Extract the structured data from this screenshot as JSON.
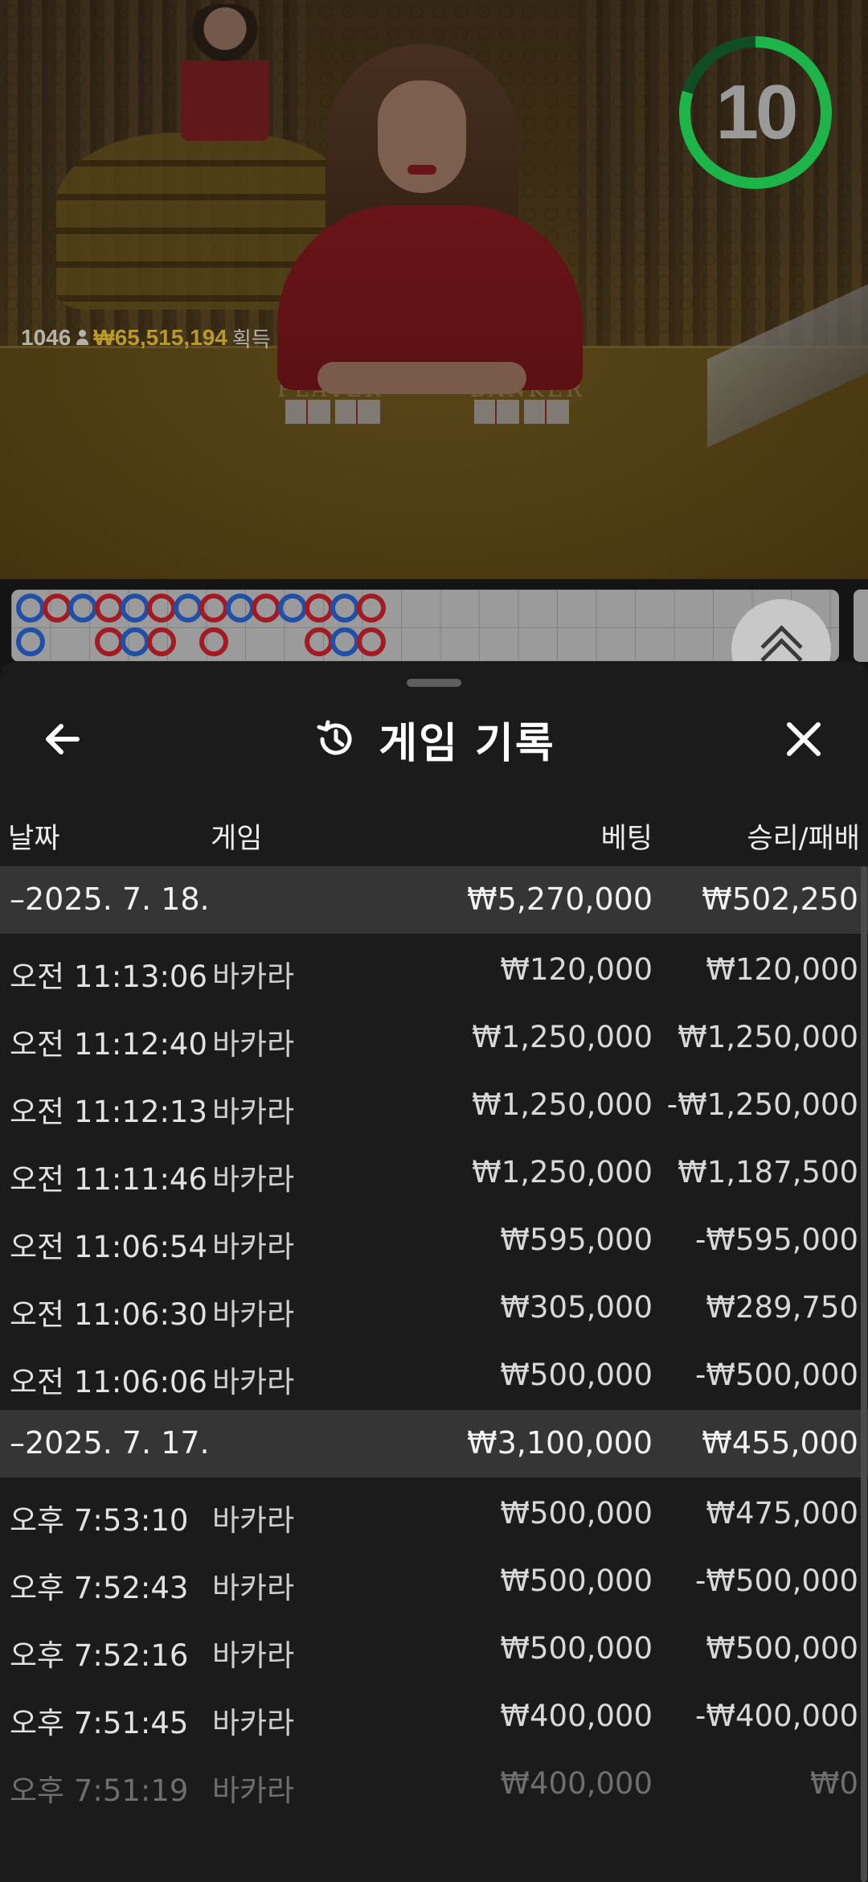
{
  "video": {
    "timer": {
      "value": "10",
      "ring_color": "#1db44a"
    },
    "winners": {
      "count": "1046",
      "amount": "₩65,515,194",
      "suffix": "획득"
    },
    "felt_labels": [
      "PLAYER",
      "BANKER"
    ]
  },
  "roadmap": {
    "colors": {
      "B": "#1f4fa6",
      "R": "#a31a22"
    },
    "top_row": [
      "B",
      "R",
      "B",
      "R",
      "B",
      "R",
      "B",
      "R",
      "B",
      "R",
      "B",
      "R",
      "B",
      "R"
    ],
    "bottom_row": [
      "B",
      "",
      "",
      "R",
      "B",
      "R",
      "",
      "R",
      "",
      "",
      "",
      "R",
      "B",
      "R"
    ]
  },
  "sheet": {
    "title": "게임 기록",
    "icons": {
      "back": "back-arrow-icon",
      "history": "history-icon",
      "close": "close-icon"
    },
    "columns": {
      "date": "날짜",
      "game": "게임",
      "bet": "베팅",
      "result": "승리/패배"
    },
    "groups": [
      {
        "date": "–2025. 7. 18.",
        "bet_total": "₩5,270,000",
        "result_total": "₩502,250",
        "rows": [
          {
            "time": "오전 11:13:06",
            "game": "바카라",
            "bet": "₩120,000",
            "result": "₩120,000"
          },
          {
            "time": "오전 11:12:40",
            "game": "바카라",
            "bet": "₩1,250,000",
            "result": "₩1,250,000"
          },
          {
            "time": "오전 11:12:13",
            "game": "바카라",
            "bet": "₩1,250,000",
            "result": "-₩1,250,000"
          },
          {
            "time": "오전 11:11:46",
            "game": "바카라",
            "bet": "₩1,250,000",
            "result": "₩1,187,500"
          },
          {
            "time": "오전 11:06:54",
            "game": "바카라",
            "bet": "₩595,000",
            "result": "-₩595,000"
          },
          {
            "time": "오전 11:06:30",
            "game": "바카라",
            "bet": "₩305,000",
            "result": "₩289,750"
          },
          {
            "time": "오전 11:06:06",
            "game": "바카라",
            "bet": "₩500,000",
            "result": "-₩500,000"
          }
        ]
      },
      {
        "date": "–2025. 7. 17.",
        "bet_total": "₩3,100,000",
        "result_total": "₩455,000",
        "rows": [
          {
            "time": "오후 7:53:10",
            "game": "바카라",
            "bet": "₩500,000",
            "result": "₩475,000"
          },
          {
            "time": "오후 7:52:43",
            "game": "바카라",
            "bet": "₩500,000",
            "result": "-₩500,000"
          },
          {
            "time": "오후 7:52:16",
            "game": "바카라",
            "bet": "₩500,000",
            "result": "₩500,000"
          },
          {
            "time": "오후 7:51:45",
            "game": "바카라",
            "bet": "₩400,000",
            "result": "-₩400,000"
          },
          {
            "time": "오후 7:51:19",
            "game": "바카라",
            "bet": "₩400,000",
            "result": "₩0"
          }
        ]
      }
    ]
  }
}
